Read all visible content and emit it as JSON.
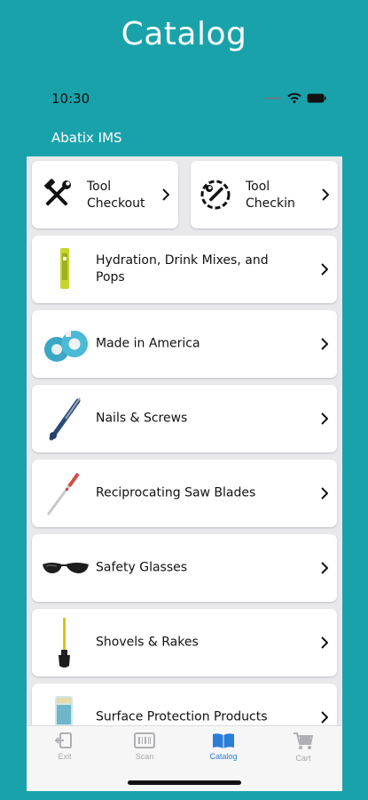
{
  "promo": {
    "title": "Catalog"
  },
  "status_bar": {
    "time": "10:30"
  },
  "header": {
    "title": "Abatix IMS"
  },
  "tools": [
    {
      "label": "Tool Checkout",
      "icon": "hammer-wrench-icon"
    },
    {
      "label": "Tool Checkin",
      "icon": "circle-wrench-icon"
    }
  ],
  "categories": [
    {
      "label": "Hydration, Drink Mixes, and Pops",
      "thumb": "drink-mix-stick-image"
    },
    {
      "label": "Made in America",
      "thumb": "tape-rolls-image"
    },
    {
      "label": "Nails & Screws",
      "thumb": "screwdriver-image"
    },
    {
      "label": "Reciprocating Saw Blades",
      "thumb": "saw-blade-image"
    },
    {
      "label": "Safety Glasses",
      "thumb": "sunglasses-image"
    },
    {
      "label": "Shovels & Rakes",
      "thumb": "shovel-image"
    },
    {
      "label": "Surface Protection Products",
      "thumb": "surface-protection-image"
    }
  ],
  "tab_bar": {
    "tabs": [
      {
        "label": "Exit",
        "icon": "exit-icon"
      },
      {
        "label": "Scan",
        "icon": "barcode-icon"
      },
      {
        "label": "Catalog",
        "icon": "book-icon",
        "active": true
      },
      {
        "label": "Cart",
        "icon": "cart-icon"
      }
    ]
  },
  "colors": {
    "brand": "#1aa2ab",
    "active_tab": "#2b7dd8"
  }
}
